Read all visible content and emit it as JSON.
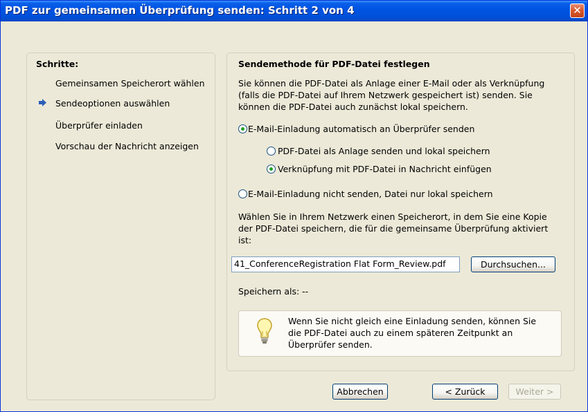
{
  "window": {
    "title": "PDF zur gemeinsamen Überprüfung senden: Schritt 2 von 4",
    "close_glyph": "✕"
  },
  "steps": {
    "heading": "Schritte:",
    "items": [
      {
        "label": "Gemeinsamen Speicherort wählen"
      },
      {
        "label": "Sendeoptionen auswählen",
        "current": true
      },
      {
        "label": "Überprüfer einladen"
      },
      {
        "label": "Vorschau der Nachricht anzeigen"
      }
    ]
  },
  "content": {
    "heading": "Sendemethode für PDF-Datei festlegen",
    "intro": [
      "Sie können die PDF-Datei als Anlage einer E-Mail oder als Verknüpfung",
      "(falls die PDF-Datei auf Ihrem Netzwerk gespeichert ist) senden. Sie",
      "können die PDF-Datei auch zunächst lokal speichern."
    ],
    "options": {
      "send_auto": "E-Mail-Einladung automatisch an Überprüfer senden",
      "attach": "PDF-Datei als Anlage senden und lokal speichern",
      "link": "Verknüpfung mit PDF-Datei in Nachricht einfügen",
      "no_send": "E-Mail-Einladung nicht senden, Datei nur lokal speichern"
    },
    "selected": {
      "main": "send_auto",
      "sub": "link"
    },
    "location_text": [
      "Wählen Sie in Ihrem Netzwerk einen Speicherort, in dem Sie eine Kopie",
      "der PDF-Datei speichern, die für die gemeinsame Überprüfung aktiviert",
      "ist:"
    ],
    "path_value": "41_ConferenceRegistration Flat Form_Review.pdf",
    "browse_label": "Durchsuchen...",
    "save_as": "Speichern als: --",
    "info": [
      "Wenn Sie nicht gleich eine Einladung senden, können Sie",
      "die PDF-Datei auch zu einem späteren Zeitpunkt an",
      "Überprüfer senden."
    ]
  },
  "buttons": {
    "cancel": "Abbrechen",
    "back": "< Zurück",
    "next": "Weiter >"
  },
  "icons": {
    "current_step": "arrow-right-icon",
    "info": "lightbulb-icon"
  },
  "colors": {
    "title_bar": "#0054e3",
    "dialog_bg": "#ece9d8",
    "radio_dot": "#21a121",
    "step_arrow": "#2b5eb8"
  }
}
